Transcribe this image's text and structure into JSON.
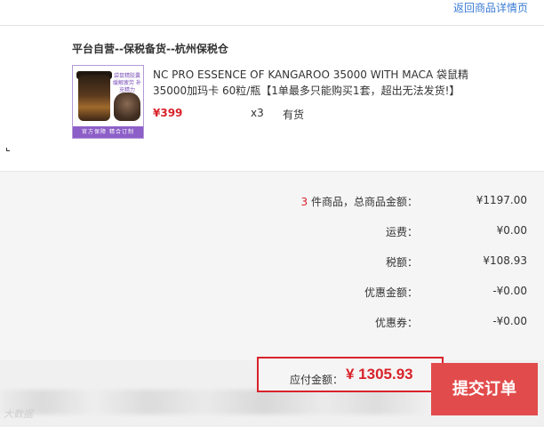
{
  "header": {
    "back_link": "返回商品详情页"
  },
  "order": {
    "warehouse": "平台自营--保税备货--杭州保税仓",
    "product": {
      "name": "NC PRO ESSENCE OF KANGAROO 35000 WITH MACA 袋鼠精35000加玛卡 60粒/瓶【1单最多只能购买1套，超出无法发货!】",
      "price": "¥399",
      "quantity": "x3",
      "stock": "有货",
      "image_tag": "袋鼠精胶囊 缓解疲劳 补充精力",
      "image_bar": "官方保障 精合订制"
    }
  },
  "summary": {
    "items_count": "3",
    "items_text": " 件商品，总商品金额：",
    "items_total": "¥1197.00",
    "shipping_label": "运费：",
    "shipping": "¥0.00",
    "tax_label": "税额：",
    "tax": "¥108.93",
    "discount_label": "优惠金额：",
    "discount": "-¥0.00",
    "coupon_label": "优惠券：",
    "coupon": "-¥0.00"
  },
  "footer": {
    "payable_label": "应付金额：",
    "payable_amount": "¥ 1305.93",
    "submit_label": "提交订单",
    "watermark": "大数据"
  },
  "colors": {
    "accent_red": "#d8232a",
    "button_red": "#e24b4b",
    "link_blue": "#3a7bd5"
  }
}
